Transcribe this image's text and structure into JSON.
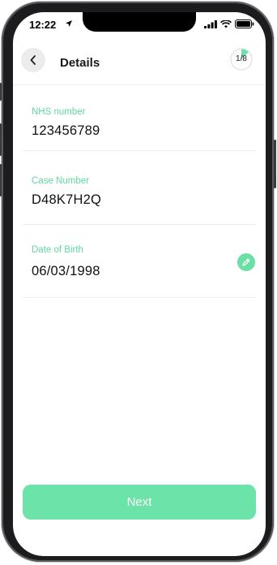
{
  "status_bar": {
    "time": "12:22"
  },
  "header": {
    "title": "Details",
    "progress_label": "1/8",
    "progress_fraction": 0.125
  },
  "fields": [
    {
      "label": "NHS number",
      "value": "123456789"
    },
    {
      "label": "Case Number",
      "value": "D48K7H2Q"
    },
    {
      "label": "Date of Birth",
      "value": "06/03/1998"
    }
  ],
  "footer": {
    "next_label": "Next"
  },
  "colors": {
    "accent": "#6ce3a8",
    "label": "#5fd8a0",
    "back_bg": "#ececee"
  },
  "icons": [
    "chevron-left-icon",
    "pencil-icon",
    "location-arrow-icon",
    "signal-icon",
    "wifi-icon",
    "battery-icon"
  ]
}
